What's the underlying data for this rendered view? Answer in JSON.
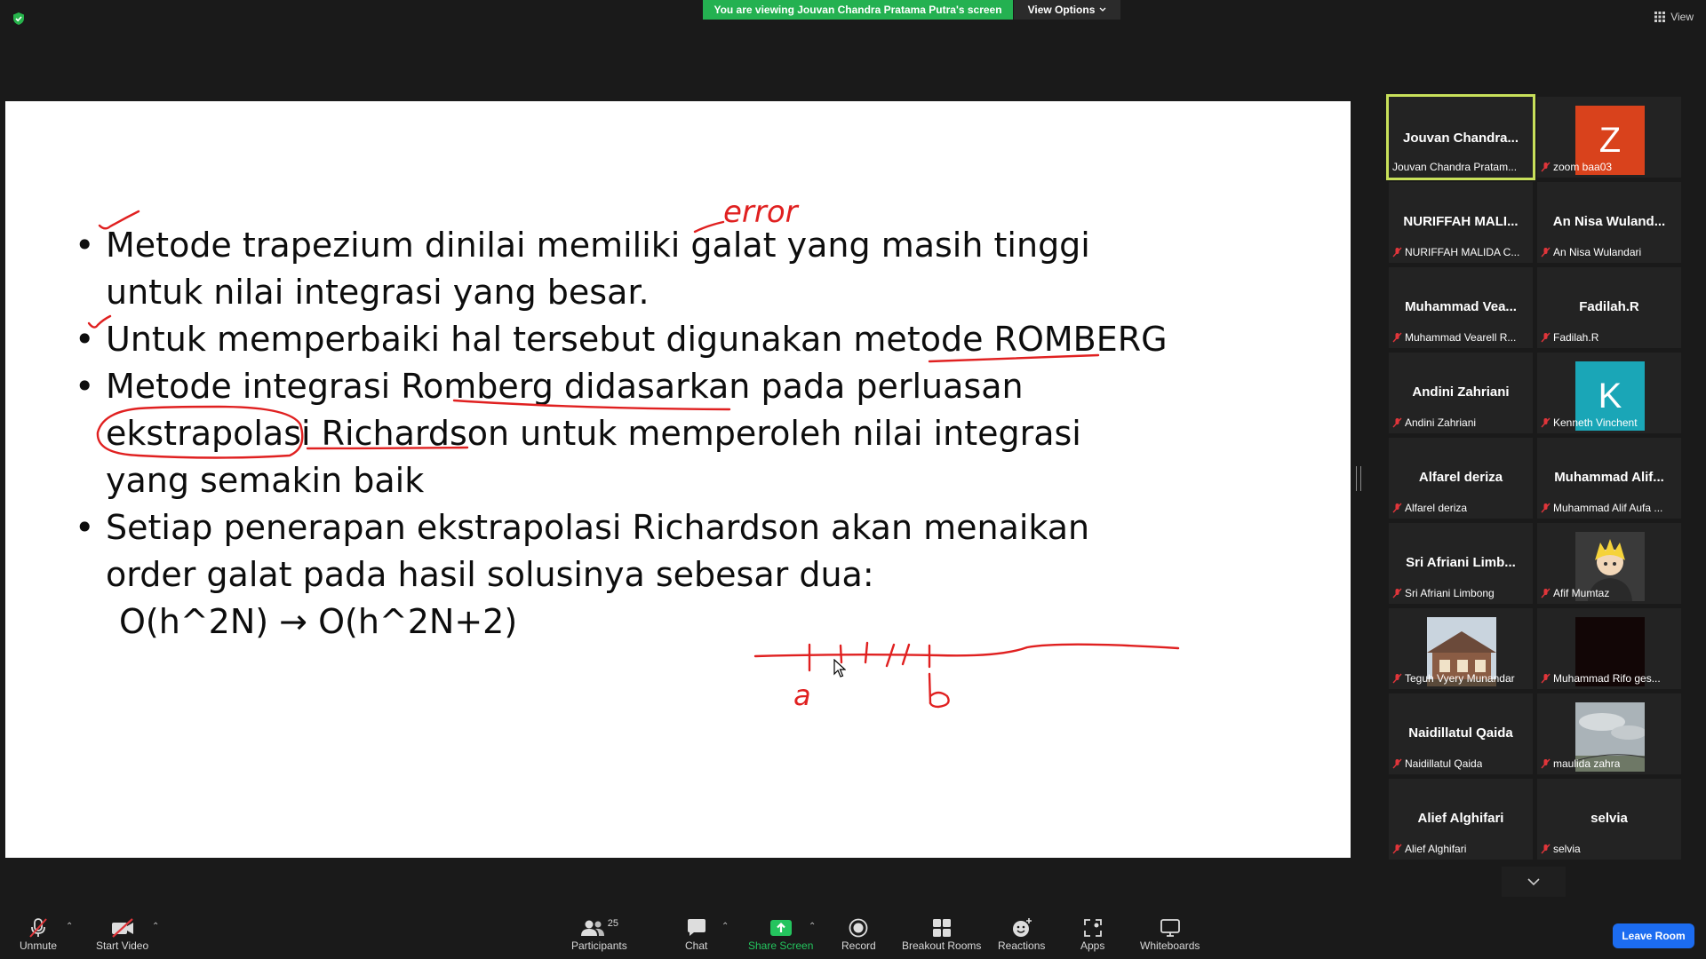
{
  "top_bar": {
    "viewing_banner": "You are viewing Jouvan Chandra Pratama Putra's screen",
    "view_options": "View Options",
    "view": "View",
    "shield_icon": "shield-check-icon",
    "grid_icon": "grid-icon"
  },
  "slide": {
    "bullets": [
      "Metode trapezium dinilai memiliki galat yang masih tinggi untuk nilai integrasi yang besar.",
      "Untuk memperbaiki hal tersebut digunakan metode ROMBERG",
      "Metode integrasi Romberg didasarkan pada perluasan ekstrapolasi Richardson untuk memperoleh nilai integrasi yang semakin baik",
      "Setiap penerapan ekstrapolasi Richardson akan menaikan order galat pada hasil solusinya sebesar dua:"
    ],
    "formula": "O(h^2N) → O(h^2N+2)",
    "annotations": {
      "word": "error",
      "a": "a",
      "b": "b"
    },
    "ink_color": "#e02020"
  },
  "participants": [
    {
      "display": "Jouvan  Chandra...",
      "label": "Jouvan Chandra Pratam...",
      "active": true
    },
    {
      "display": "Z",
      "label": "zoom baa03",
      "avatar_color": "#d9421c"
    },
    {
      "display": "NURIFFAH MALI...",
      "label": "NURIFFAH MALIDA C..."
    },
    {
      "display": "An Nisa Wuland...",
      "label": "An Nisa Wulandari"
    },
    {
      "display": "Muhammad  Vea...",
      "label": "Muhammad Vearell R..."
    },
    {
      "display": "Fadilah.R",
      "label": "Fadilah.R"
    },
    {
      "display": "Andini Zahriani",
      "label": "Andini Zahriani"
    },
    {
      "display": "K",
      "label": "Kenneth Vinchent",
      "avatar_color": "#1aa6b7"
    },
    {
      "display": "Alfarel deriza",
      "label": "Alfarel deriza"
    },
    {
      "display": "Muhammad  Alif...",
      "label": "Muhammad Alif Aufa ..."
    },
    {
      "display": "Sri Afriani Limb...",
      "label": "Sri Afriani Limbong"
    },
    {
      "display": "",
      "label": "Afif Mumtaz",
      "picture": "anime-avatar"
    },
    {
      "display": "",
      "label": "Teguh Vyery Munandar",
      "picture": "house-photo"
    },
    {
      "display": "",
      "label": "Muhammad Rifo ges...",
      "picture": "dark-video"
    },
    {
      "display": "Naidillatul Qaida",
      "label": "Naidillatul Qaida"
    },
    {
      "display": "",
      "label": "maulida zahra",
      "picture": "sky-photo"
    },
    {
      "display": "Alief Alghifari",
      "label": "Alief Alghifari"
    },
    {
      "display": "selvia",
      "label": "selvia"
    }
  ],
  "toolbar": {
    "unmute": "Unmute",
    "start_video": "Start Video",
    "participants": "Participants",
    "participants_count": "25",
    "chat": "Chat",
    "share_screen": "Share Screen",
    "record": "Record",
    "breakout_rooms": "Breakout Rooms",
    "reactions": "Reactions",
    "apps": "Apps",
    "whiteboards": "Whiteboards",
    "leave_room": "Leave Room"
  },
  "colors": {
    "banner_green": "#24b151",
    "active_speaker": "#c8e05a",
    "leave_blue": "#1c6cf0",
    "muted_red": "#e0353a"
  }
}
